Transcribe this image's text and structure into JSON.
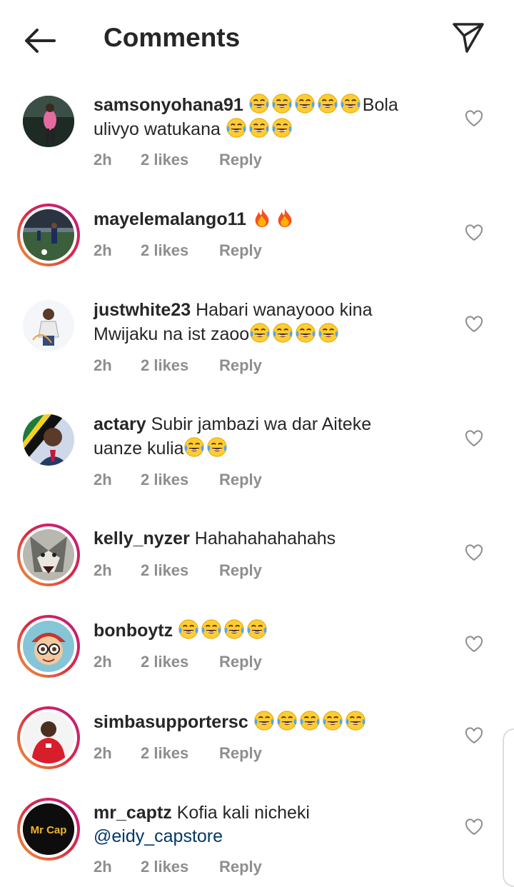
{
  "header": {
    "title": "Comments"
  },
  "comments": [
    {
      "username": "samsonyohana91",
      "text1": "",
      "text2": "Bola",
      "text3": "ulivyo watukana",
      "time": "2h",
      "likes": "2 likes",
      "reply": "Reply"
    },
    {
      "username": "mayelemalango11",
      "text": "",
      "time": "2h",
      "likes": "2 likes",
      "reply": "Reply"
    },
    {
      "username": "justwhite23",
      "text1": "Habari wanayooo kina",
      "text2": "Mwijaku na ist zaoo",
      "time": "2h",
      "likes": "2 likes",
      "reply": "Reply"
    },
    {
      "username": "actary",
      "text1": "Subir jambazi wa dar Aiteke",
      "text2": "uanze kulia",
      "time": "2h",
      "likes": "2 likes",
      "reply": "Reply"
    },
    {
      "username": "kelly_nyzer",
      "text": "Hahahahahahahs",
      "time": "2h",
      "likes": "2 likes",
      "reply": "Reply"
    },
    {
      "username": "bonboytz",
      "text": "",
      "time": "2h",
      "likes": "2 likes",
      "reply": "Reply"
    },
    {
      "username": "simbasupportersc",
      "text": "",
      "time": "2h",
      "likes": "2 likes",
      "reply": "Reply"
    },
    {
      "username": "mr_captz",
      "text1": "Kofia kali nicheki",
      "mention": "@eidy_capstore",
      "time": "2h",
      "likes": "2 likes",
      "reply": "Reply"
    }
  ],
  "avatar_text": {
    "mr_captz": "Mr Cap"
  },
  "icons": {
    "back": "arrow-left-icon",
    "send": "paper-plane-icon",
    "like": "heart-outline-icon",
    "laugh": "tears-of-joy-emoji",
    "fire": "fire-emoji"
  },
  "colors": {
    "story_ring": "#dc2743",
    "meta": "#8e8e8e",
    "mention": "#00376b"
  }
}
